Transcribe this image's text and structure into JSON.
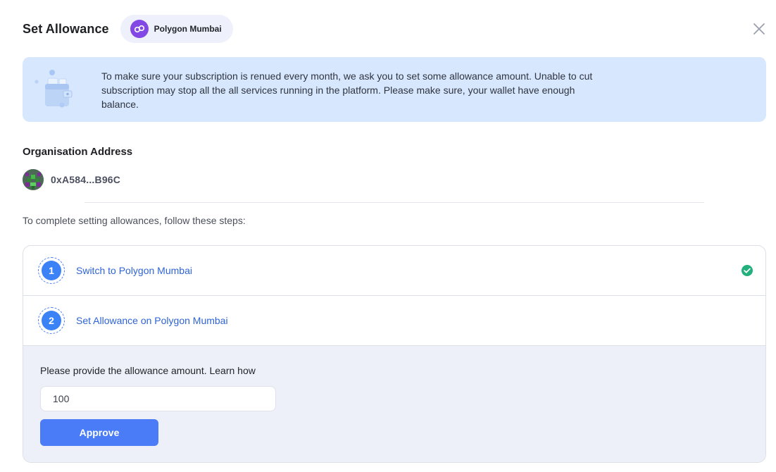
{
  "header": {
    "title": "Set Allowance",
    "network_label": "Polygon Mumbai"
  },
  "banner": {
    "text": "To make sure your subscription is renued every month, we ask you to set some allowance amount. Unable to cut subscription may stop all the all services running in the platform. Please make sure, your wallet have enough balance."
  },
  "organisation": {
    "title": "Organisation Address",
    "address": "0xA584...B96C"
  },
  "instructions": "To complete setting allowances, follow these steps:",
  "steps": [
    {
      "number": "1",
      "label": "Switch to Polygon Mumbai",
      "completed": true
    },
    {
      "number": "2",
      "label": "Set Allowance on Polygon Mumbai",
      "completed": false
    }
  ],
  "allowance": {
    "label": "Please provide the allowance amount. Learn how",
    "value": "100",
    "button_label": "Approve"
  },
  "colors": {
    "accent": "#4a7cf7",
    "step_link": "#2e64d6",
    "banner_bg": "#d7e7fd",
    "panel_bg": "#edf0f8",
    "success": "#22b07d",
    "polygon": "#8247e5"
  },
  "icons": {
    "close": "close-icon",
    "network": "polygon-icon",
    "check": "check-circle-icon",
    "banner": "wallet-illustration"
  }
}
